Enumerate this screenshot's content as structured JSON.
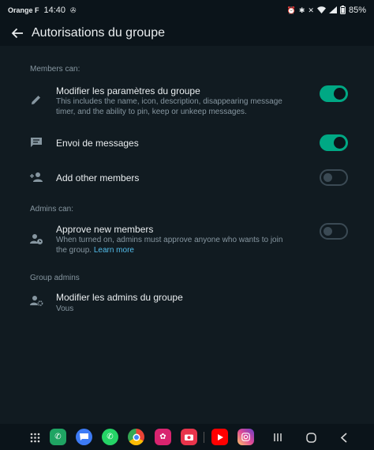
{
  "status_bar": {
    "carrier": "Orange F",
    "time": "14:40",
    "battery": "85%"
  },
  "header": {
    "title": "Autorisations du groupe"
  },
  "members_section": {
    "label": "Members can:",
    "items": [
      {
        "title": "Modifier les paramètres du groupe",
        "description": "This includes the name, icon, description, disappearing message timer, and the ability to pin, keep or unkeep messages.",
        "enabled": true
      },
      {
        "title": "Envoi de messages",
        "enabled": true
      },
      {
        "title": "Add other members",
        "enabled": false
      }
    ]
  },
  "admins_section": {
    "label": "Admins can:",
    "items": [
      {
        "title": "Approve new members",
        "description": "When turned on, admins must approve anyone who wants to join the group.",
        "link": "Learn more",
        "enabled": false
      }
    ]
  },
  "group_admins_section": {
    "label": "Group admins",
    "items": [
      {
        "title": "Modifier les admins du groupe",
        "subtitle": "Vous"
      }
    ]
  },
  "colors": {
    "accent": "#00a884",
    "background": "#111b21",
    "link": "#53bdeb"
  }
}
